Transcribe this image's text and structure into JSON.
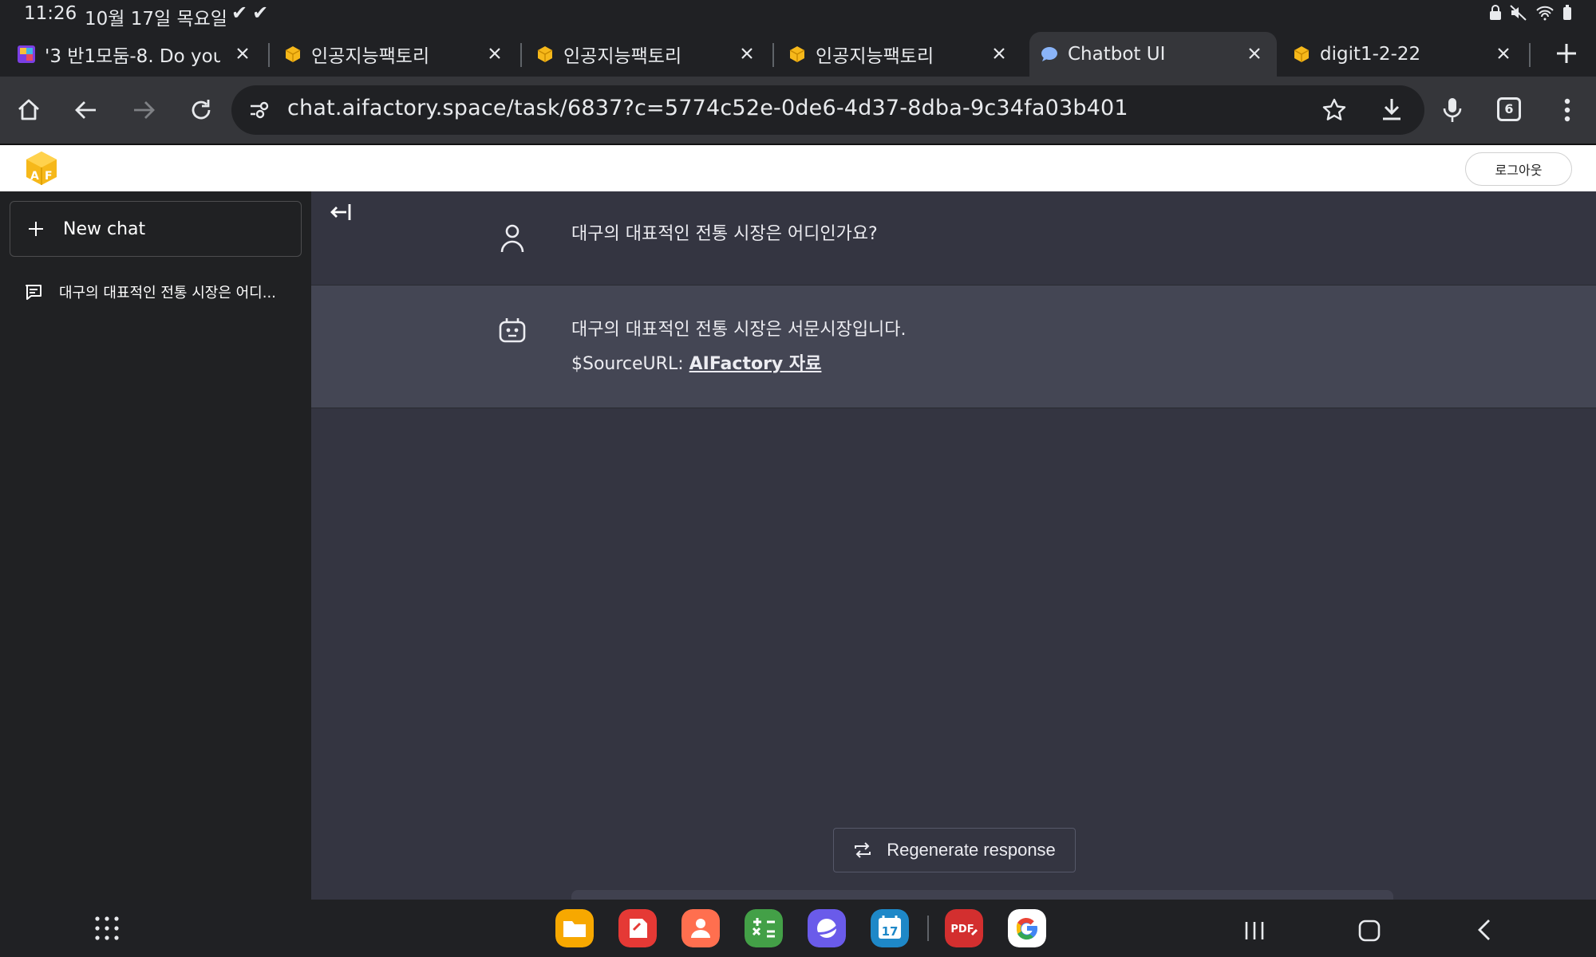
{
  "status_bar": {
    "time": "11:26",
    "date": "10월 17일 목요일"
  },
  "tabs": [
    {
      "title": "'3 반1모둠-8. Do you w",
      "favicon": "colorful-icon"
    },
    {
      "title": "인공지능팩토리",
      "favicon": "aifactory-cube-icon"
    },
    {
      "title": "인공지능팩토리",
      "favicon": "aifactory-cube-icon"
    },
    {
      "title": "인공지능팩토리",
      "favicon": "aifactory-cube-icon"
    },
    {
      "title": "Chatbot UI",
      "favicon": "chat-bubble-icon",
      "active": true
    },
    {
      "title": "digit1-2-22",
      "favicon": "aifactory-cube-icon"
    }
  ],
  "toolbar": {
    "url": "chat.aifactory.space/task/6837?c=5774c52e-0de6-4d37-8dba-9c34fa03b401",
    "tab_count": "6"
  },
  "header": {
    "logout_label": "로그아웃"
  },
  "sidebar": {
    "new_chat_label": "New chat",
    "conversations": [
      {
        "title": "대구의 대표적인 전통 시장은 어디..."
      }
    ]
  },
  "chat": {
    "messages": [
      {
        "role": "user",
        "text": "대구의 대표적인 전통 시장은 어디인가요?"
      },
      {
        "role": "assistant",
        "text": "대구의 대표적인 전통 시장은 서문시장입니다.",
        "source_prefix": "$SourceURL: ",
        "source_link": "AIFactory 자료"
      }
    ],
    "regenerate_label": "Regenerate response"
  },
  "colors": {
    "main_bg": "#343541",
    "assistant_bg": "#444654",
    "sidebar_bg": "#202123",
    "chrome_dark": "#202124",
    "chrome_toolbar": "#35363a",
    "logo_yellow": "#f6b81a"
  },
  "dock_apps": [
    "files-icon",
    "notes-icon",
    "contacts-icon",
    "calculator-icon",
    "internet-icon",
    "calendar-icon",
    "pdf-icon",
    "google-icon"
  ],
  "dock_calendar_day": "17"
}
